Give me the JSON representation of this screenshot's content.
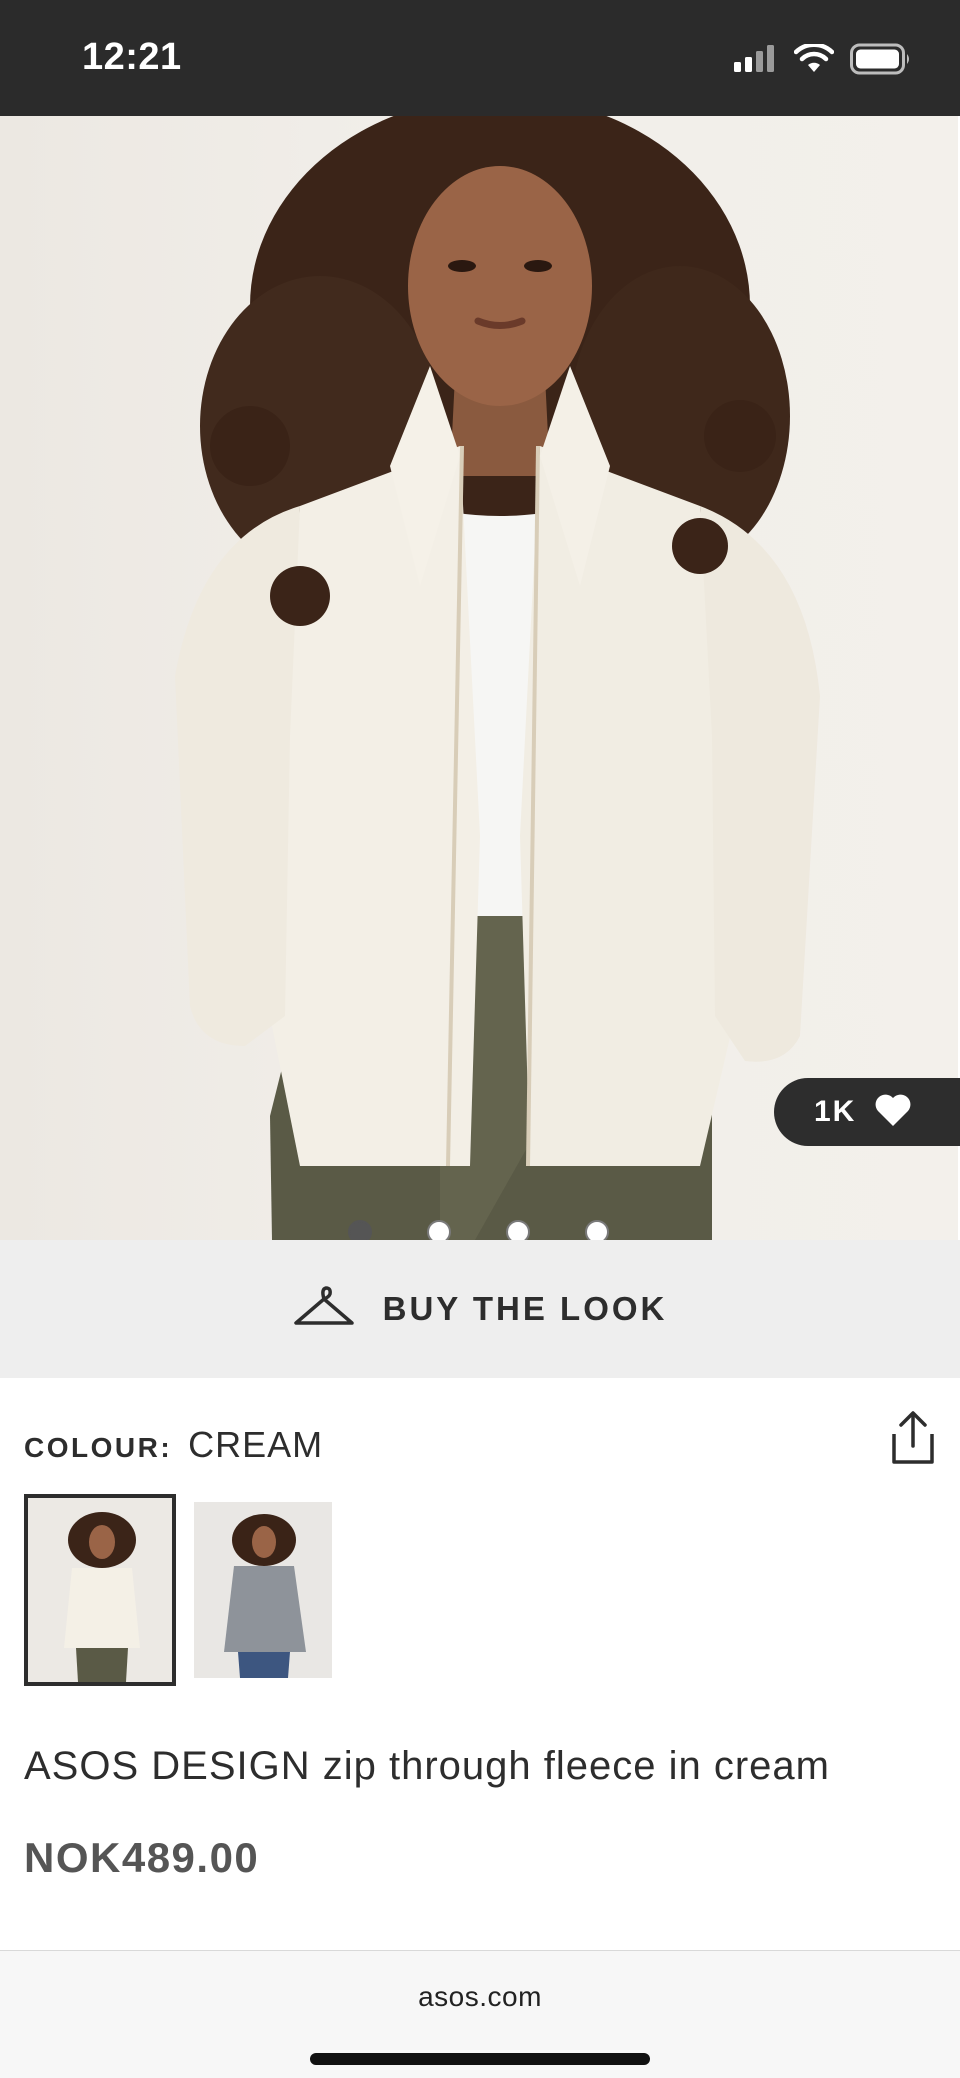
{
  "status_bar": {
    "time": "12:21",
    "icons": [
      "signal-icon",
      "wifi-icon",
      "battery-icon"
    ]
  },
  "gallery": {
    "image_count": 4,
    "active_index": 0,
    "likes": "1K"
  },
  "buy_the_look": {
    "label": "BUY THE LOOK",
    "icon": "hanger-icon"
  },
  "colour": {
    "key": "COLOUR:",
    "value": "CREAM",
    "options": [
      "cream",
      "grey"
    ],
    "selected": "cream"
  },
  "product": {
    "title": "ASOS DESIGN zip through fleece in cream",
    "price": "NOK489.00"
  },
  "browser": {
    "url": "asos.com"
  },
  "colors": {
    "status_bar_bg": "#2b2b2b",
    "buy_look_bg": "#eeeeee",
    "text_primary": "#2d2d2d",
    "price_text": "#555555"
  }
}
